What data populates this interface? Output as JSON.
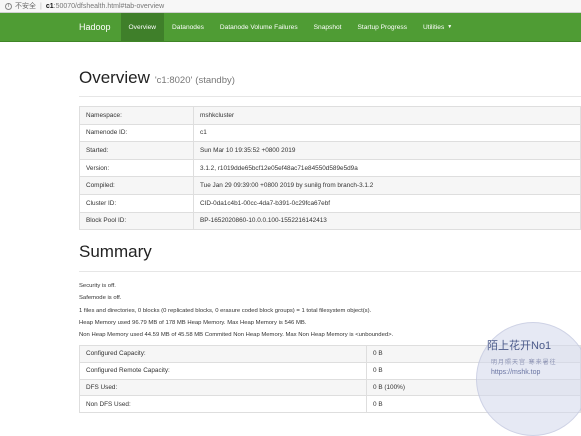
{
  "browser": {
    "security": "不安全",
    "host": "c1",
    "url_rest": ":50070/dfshealth.html#tab-overview"
  },
  "navbar": {
    "brand": "Hadoop",
    "items": [
      {
        "label": "Overview",
        "active": true
      },
      {
        "label": "Datanodes"
      },
      {
        "label": "Datanode Volume Failures"
      },
      {
        "label": "Snapshot"
      },
      {
        "label": "Startup Progress"
      },
      {
        "label": "Utilities"
      }
    ]
  },
  "overview": {
    "title": "Overview",
    "node": "'c1:8020'",
    "state": "(standby)",
    "rows": [
      {
        "key": "Namespace:",
        "value": "mshkcluster"
      },
      {
        "key": "Namenode ID:",
        "value": "c1"
      },
      {
        "key": "Started:",
        "value": "Sun Mar 10 19:35:52 +0800 2019"
      },
      {
        "key": "Version:",
        "value": "3.1.2, r1019dde65bcf12e05ef48ac71e84550d589e5d9a"
      },
      {
        "key": "Compiled:",
        "value": "Tue Jan 29 09:39:00 +0800 2019 by sunilg from branch-3.1.2"
      },
      {
        "key": "Cluster ID:",
        "value": "CID-0da1c4b1-00cc-4da7-b391-0c29fca67ebf"
      },
      {
        "key": "Block Pool ID:",
        "value": "BP-1652020860-10.0.0.100-1552216142413"
      }
    ]
  },
  "summary": {
    "title": "Summary",
    "lines": [
      "Security is off.",
      "Safemode is off.",
      "1 files and directories, 0 blocks (0 replicated blocks, 0 erasure coded block groups) = 1 total filesystem object(s).",
      "Heap Memory used 96.79 MB of 178 MB Heap Memory. Max Heap Memory is 546 MB.",
      "Non Heap Memory used 44.59 MB of 45.58 MB Commited Non Heap Memory. Max Non Heap Memory is <unbounded>."
    ],
    "rows": [
      {
        "key": "Configured Capacity:",
        "value": "0 B"
      },
      {
        "key": "Configured Remote Capacity:",
        "value": "0 B"
      },
      {
        "key": "DFS Used:",
        "value": "0 B (100%)"
      },
      {
        "key": "Non DFS Used:",
        "value": "0 B"
      }
    ]
  },
  "watermark": {
    "line1": "陌上花开No1",
    "line2": "明月照天宫    寒来暑往",
    "line3": "https://mshk.top"
  }
}
